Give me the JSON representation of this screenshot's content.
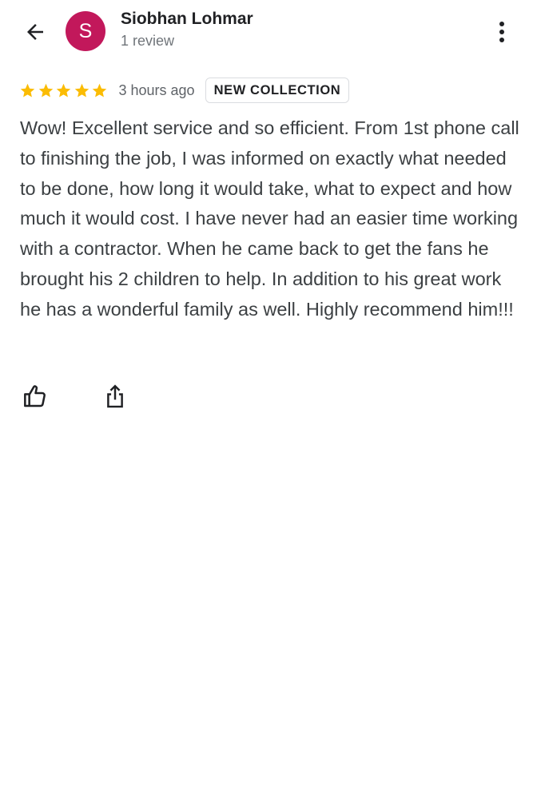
{
  "header": {
    "back_icon": "arrow-back-icon",
    "avatar_letter": "S",
    "avatar_color": "#c2185b",
    "user_name": "Siobhan Lohmar",
    "review_count": "1 review",
    "more_icon": "more-vert-icon"
  },
  "review": {
    "rating": 5,
    "rating_max": 5,
    "star_color": "#fbbc04",
    "time_ago": "3 hours ago",
    "badge": "NEW COLLECTION",
    "text": "Wow! Excellent service and so efficient. From 1st phone call to finishing the job, I was informed on exactly what needed to be done, how long it would take, what to expect and how much it would cost. I have never had an easier time working with a contractor. When he came back to get the fans he brought his 2 children to help. In addition to his great work he has a wonderful family as well. Highly recommend him!!!"
  },
  "actions": {
    "like_icon": "thumb-up-icon",
    "share_icon": "share-icon"
  }
}
